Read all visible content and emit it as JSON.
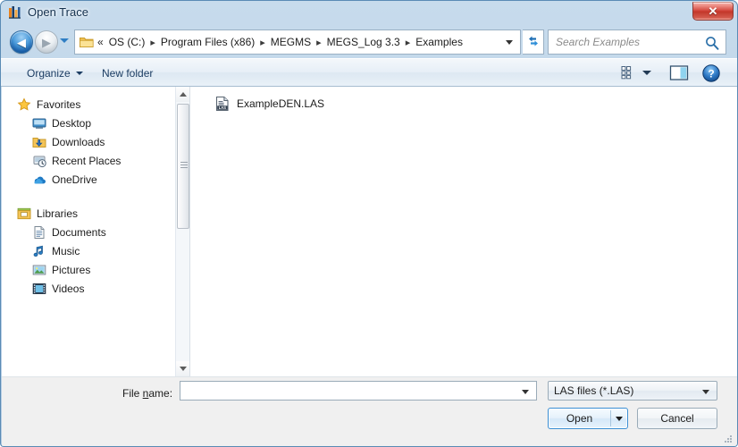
{
  "window": {
    "title": "Open Trace",
    "icon": "app-chart-icon",
    "close_label": "✕"
  },
  "navigation": {
    "back_icon": "back-arrow-icon",
    "back_glyph": "◀",
    "forward_icon": "forward-arrow-icon",
    "forward_glyph": "▶",
    "recent_locations_icon": "chevron-down-icon",
    "refresh_icon": "refresh-icon",
    "address": {
      "folder_icon": "folder-icon",
      "overflow": "«",
      "separator": "▸",
      "crumbs": [
        "OS (C:)",
        "Program Files (x86)",
        "MEGMS",
        "MEGS_Log 3.3",
        "Examples"
      ]
    },
    "search": {
      "placeholder": "Search Examples",
      "value": "",
      "icon": "search-icon"
    }
  },
  "toolbar": {
    "organize_label": "Organize",
    "new_folder_label": "New folder",
    "view_mode_icon": "view-mode-icon",
    "preview_pane_icon": "preview-pane-icon",
    "help_icon": "help-icon"
  },
  "nav_pane": {
    "groups": [
      {
        "label": "Favorites",
        "icon": "star-icon",
        "items": [
          {
            "label": "Desktop",
            "icon": "desktop-icon"
          },
          {
            "label": "Downloads",
            "icon": "downloads-icon"
          },
          {
            "label": "Recent Places",
            "icon": "recent-places-icon"
          },
          {
            "label": "OneDrive",
            "icon": "onedrive-cloud-icon"
          }
        ]
      },
      {
        "label": "Libraries",
        "icon": "libraries-icon",
        "items": [
          {
            "label": "Documents",
            "icon": "documents-icon"
          },
          {
            "label": "Music",
            "icon": "music-note-icon"
          },
          {
            "label": "Pictures",
            "icon": "pictures-icon"
          },
          {
            "label": "Videos",
            "icon": "videos-film-icon"
          }
        ]
      }
    ],
    "scrollbar": {
      "up_icon": "scroll-up-arrow-icon",
      "down_icon": "scroll-down-arrow-icon"
    }
  },
  "file_list": {
    "items": [
      {
        "name": "ExampleDEN.LAS",
        "icon": "las-file-icon",
        "icon_text": "LAS"
      }
    ]
  },
  "footer": {
    "filename_label_before": "File ",
    "filename_label_accel": "n",
    "filename_label_after": "ame:",
    "filename_value": "",
    "filename_placeholder": "",
    "filetype_value": "LAS files (*.LAS)",
    "filetype_options": [
      "LAS files (*.LAS)"
    ],
    "open_label": "Open",
    "open_dropdown_icon": "chevron-down-icon",
    "cancel_label": "Cancel",
    "resize_grip_icon": "resize-grip-icon"
  },
  "colors": {
    "title_bar": "#bdd3e8",
    "accent_focus": "#3c8fd4",
    "close_red": "#cf4035",
    "toolbar_bg": "#e7eff7",
    "footer_bg": "#f0f0f0"
  }
}
